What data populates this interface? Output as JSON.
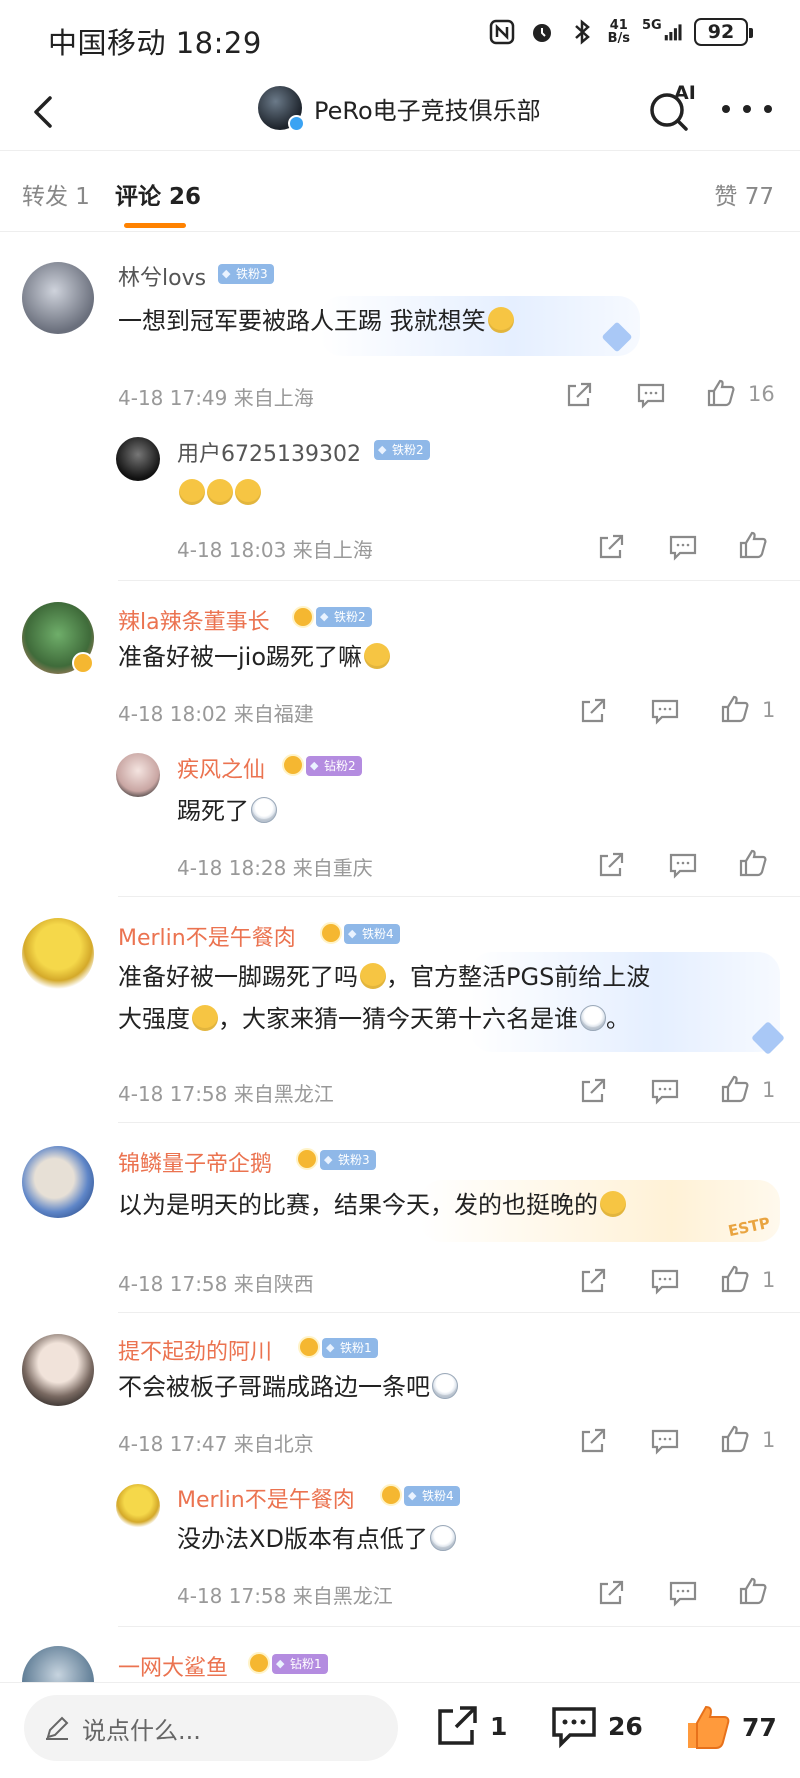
{
  "status_bar": {
    "carrier_time": "中国移动 18:29",
    "net_speed_top": "41",
    "net_speed_bottom": "B/s",
    "network": "5G",
    "battery": "92"
  },
  "nav": {
    "title": "PeRo电子竞技俱乐部",
    "ai_label": "AI"
  },
  "tabs": {
    "repost": "转发 1",
    "comments": "评论 26",
    "likes": "赞 77"
  },
  "comments": [
    {
      "name": "林兮lovs",
      "badge": "铁粉3",
      "text": "一想到冠军要被路人王踢 我就想笑",
      "time": "4-18 17:49 来自上海",
      "likes": "16"
    },
    {
      "name": "用户6725139302",
      "badge": "铁粉2",
      "text": "",
      "time": "4-18 18:03 来自上海",
      "likes": ""
    },
    {
      "name": "辣la辣条董事长",
      "badge": "铁粉2",
      "text": "准备好被一jio踢死了嘛",
      "time": "4-18 18:02 来自福建",
      "likes": "1"
    },
    {
      "name": "疾风之仙",
      "badge": "钻粉2",
      "text": "踢死了",
      "time": "4-18 18:28 来自重庆",
      "likes": ""
    },
    {
      "name": "Merlin不是午餐肉",
      "badge": "铁粉4",
      "text_line1": "准备好被一脚踢死了吗",
      "text_line1b": "，官方整活PGS前给上波",
      "text_line2a": "大强度",
      "text_line2b": "，大家来猜一猜今天第十六名是谁",
      "text_line2c": "。",
      "time": "4-18 17:58 来自黑龙江",
      "likes": "1"
    },
    {
      "name": "锦鳞量子帝企鹅",
      "badge": "铁粉3",
      "text": "以为是明天的比赛，结果今天，发的也挺晚的",
      "time": "4-18 17:58 来自陕西",
      "likes": "1"
    },
    {
      "name": "提不起劲的阿川",
      "badge": "铁粉1",
      "text": "不会被板子哥踹成路边一条吧",
      "time": "4-18 17:47 来自北京",
      "likes": "1"
    },
    {
      "name": "Merlin不是午餐肉",
      "badge": "铁粉4",
      "text": "没办法XD版本有点低了",
      "time": "4-18 17:58 来自黑龙江",
      "likes": ""
    },
    {
      "name": "一网大鲨鱼",
      "badge": "钻粉1",
      "text": "",
      "time": "",
      "likes": ""
    }
  ],
  "estp_tag": "ESTP",
  "bottom_bar": {
    "placeholder": "说点什么...",
    "repost_count": "1",
    "comment_count": "26",
    "like_count": "77"
  },
  "colors": {
    "accent": "#ff8200",
    "name_orange": "#eb7350",
    "meta_gray": "#999999"
  }
}
